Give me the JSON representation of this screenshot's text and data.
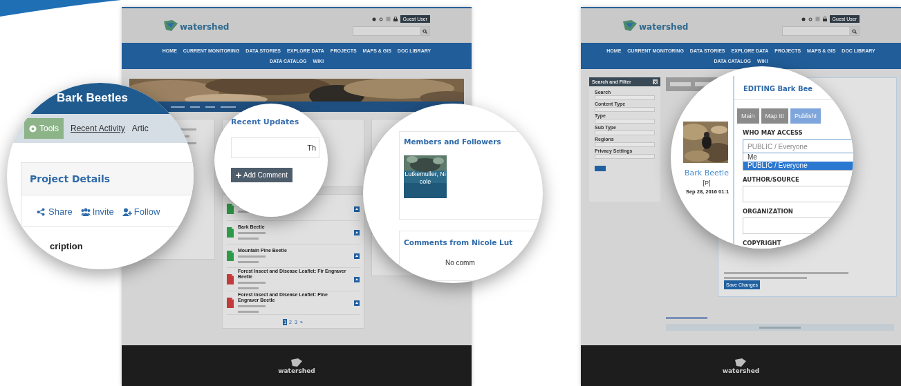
{
  "left_page": {
    "kind": "project",
    "logo": "watershed",
    "user_button": "Guest User",
    "nav_rows": [
      [
        "HOME",
        "CURRENT MONITORING",
        "DATA STORIES",
        "EXPLORE DATA",
        "PROJECTS",
        "MAPS & GIS",
        "DOC LIBRARY"
      ],
      [
        "DATA CATALOG",
        "WIKI"
      ]
    ],
    "documents": [
      {
        "kind": "jpg"
      },
      {
        "kind": "jpg",
        "title": "Bark Beetle"
      },
      {
        "kind": "jpg",
        "title": "Mountain Pine Beetle"
      },
      {
        "kind": "pdf",
        "title": "Forest Insect and Disease Leaflet: Fir Engraver Beetle"
      },
      {
        "kind": "pdf",
        "title": "Forest Insect and Disease Leaflet: Pine Engraver Beetle"
      }
    ],
    "pages": [
      {
        "label": "1",
        "selected": true
      },
      {
        "label": "2",
        "selected": false
      },
      {
        "label": "3",
        "selected": false
      },
      {
        "label": "»",
        "selected": false
      }
    ],
    "footer_logo": "watershed"
  },
  "lens_project": {
    "kind": "project",
    "title": "Bark Beetles",
    "tabs": [
      {
        "label": "Tools",
        "kind": "button"
      },
      {
        "label": "Recent Activity",
        "kind": "link"
      },
      {
        "label": "Artic",
        "kind": "text"
      }
    ],
    "panel_title": "Project Details",
    "actions": [
      {
        "label": "Share",
        "kind": "share"
      },
      {
        "label": "Invite",
        "kind": "invite"
      },
      {
        "label": "Follow",
        "kind": "follow"
      }
    ],
    "section": "cription"
  },
  "lens_updates": {
    "kind": "updates",
    "title": "Recent Updates",
    "message": "Th",
    "button": "Add Comment"
  },
  "lens_members": {
    "kind": "members",
    "title": "Members and Followers",
    "member": "Lutkemuller, Nicole",
    "comments_title": "Comments from Nicole Lut",
    "comments_empty": "No comm"
  },
  "right_page": {
    "kind": "library",
    "logo": "watershed",
    "user_button": "Guest User",
    "nav_rows": [
      [
        "HOME",
        "CURRENT MONITORING",
        "DATA STORIES",
        "EXPLORE DATA",
        "PROJECTS",
        "MAPS & GIS",
        "DOC LIBRARY"
      ],
      [
        "DATA CATALOG",
        "WIKI"
      ]
    ],
    "filter_title": "Search and Filter",
    "filter_labels": [
      "Search",
      "Content Type",
      "Type",
      "Sub Type",
      "Regions",
      "Privacy Settings"
    ],
    "save_button": "Save Changes",
    "footer_logo": "watershed"
  },
  "lens_edit": {
    "kind": "edit",
    "item_title": "Bark Beetle",
    "item_tag": "[P]",
    "item_date": "Sep 28, 2016 01:1",
    "modal_title": "EDITING Bark Bee",
    "tabs": [
      {
        "label": "Main",
        "selected": false
      },
      {
        "label": "Map It!",
        "selected": false
      },
      {
        "label": "Publish!",
        "selected": true
      }
    ],
    "fields": [
      {
        "kind": "select",
        "label": "WHO MAY ACCESS",
        "value": "PUBLIC / Everyone",
        "options": [
          {
            "label": "Me",
            "selected": false
          },
          {
            "label": "PUBLIC / Everyone",
            "selected": true
          }
        ]
      },
      {
        "kind": "text",
        "label": "AUTHOR/SOURCE"
      },
      {
        "kind": "text",
        "label": "ORGANIZATION"
      },
      {
        "kind": "heading",
        "label": "COPYRIGHT"
      }
    ]
  }
}
